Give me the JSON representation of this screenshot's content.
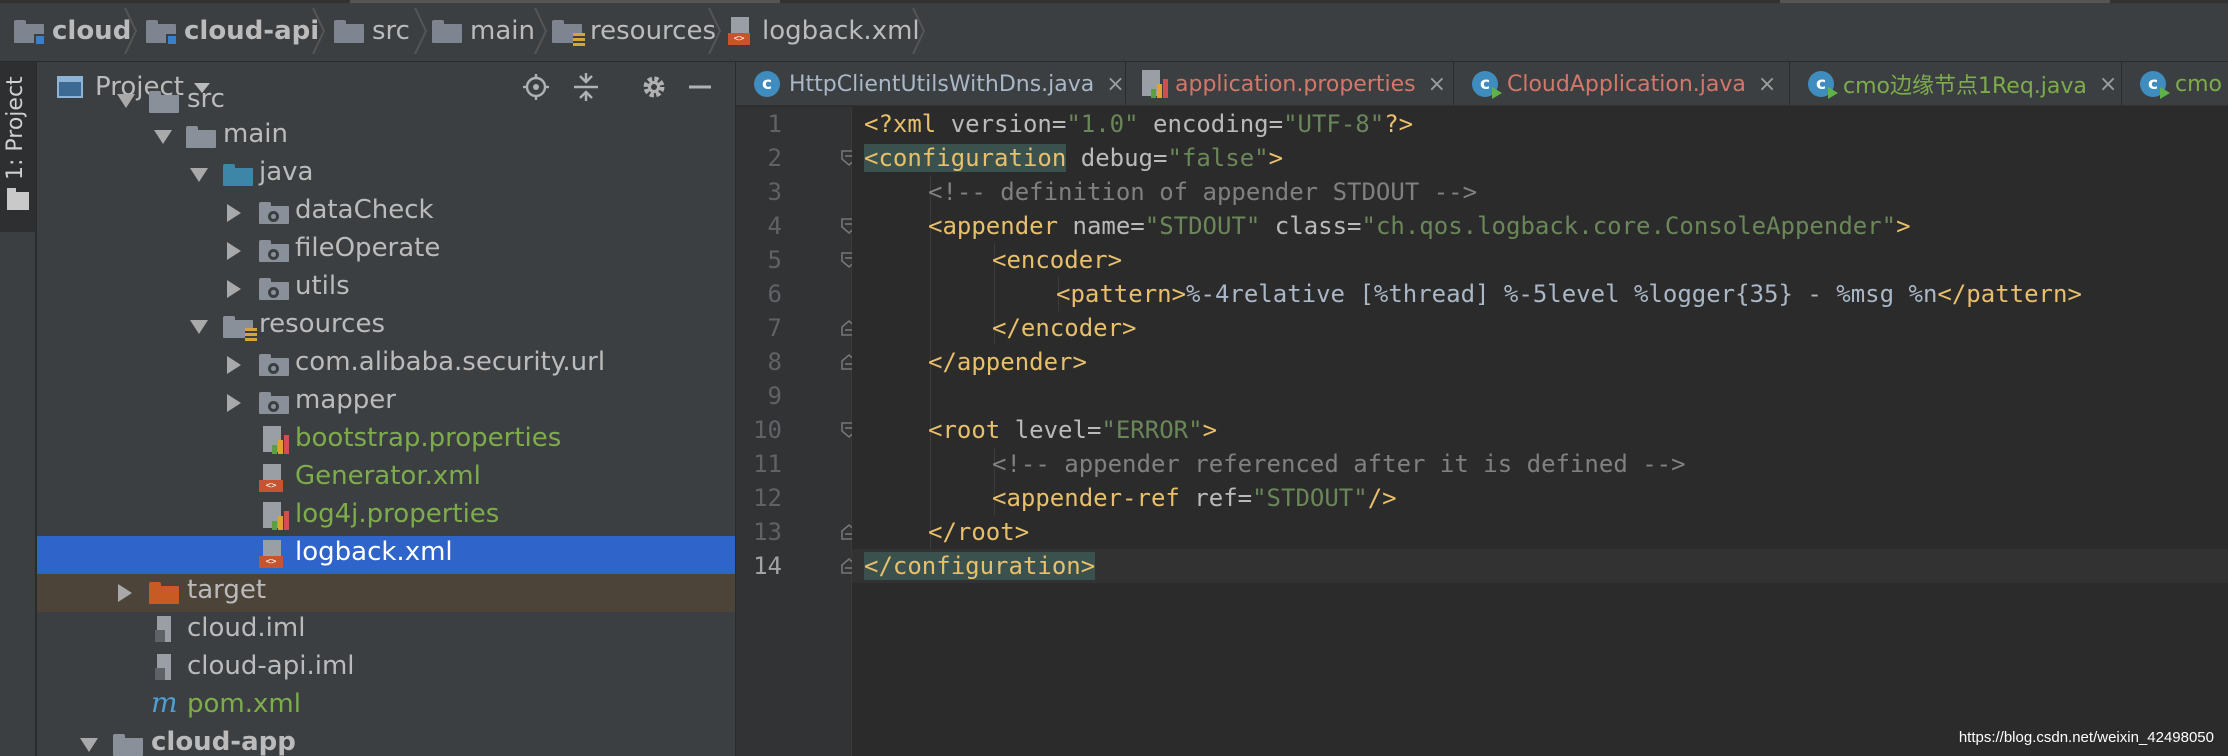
{
  "breadcrumb": {
    "items": [
      {
        "label": "cloud",
        "icon": "module-folder-icon"
      },
      {
        "label": "cloud-api",
        "icon": "module-folder-icon"
      },
      {
        "label": "src",
        "icon": "folder-icon"
      },
      {
        "label": "main",
        "icon": "folder-icon"
      },
      {
        "label": "resources",
        "icon": "resources-folder-icon"
      },
      {
        "label": "logback.xml",
        "icon": "xml-file-icon"
      }
    ]
  },
  "stripe": {
    "project_tab": "1: Project"
  },
  "project_panel": {
    "title": "Project",
    "tree": [
      {
        "label": "src",
        "type": "folder",
        "expanded": true
      },
      {
        "label": "main",
        "type": "folder",
        "expanded": true
      },
      {
        "label": "java",
        "type": "source-folder",
        "expanded": true
      },
      {
        "label": "dataCheck",
        "type": "package",
        "expanded": false
      },
      {
        "label": "fileOperate",
        "type": "package",
        "expanded": false
      },
      {
        "label": "utils",
        "type": "package",
        "expanded": false
      },
      {
        "label": "resources",
        "type": "resources-folder",
        "expanded": true
      },
      {
        "label": "com.alibaba.security.url",
        "type": "package",
        "expanded": false
      },
      {
        "label": "mapper",
        "type": "package",
        "expanded": false
      },
      {
        "label": "bootstrap.properties",
        "type": "properties"
      },
      {
        "label": "Generator.xml",
        "type": "xml"
      },
      {
        "label": "log4j.properties",
        "type": "properties"
      },
      {
        "label": "logback.xml",
        "type": "xml",
        "selected": true
      },
      {
        "label": "target",
        "type": "excluded-folder",
        "expanded": false
      },
      {
        "label": "cloud.iml",
        "type": "iml"
      },
      {
        "label": "cloud-api.iml",
        "type": "iml"
      },
      {
        "label": "pom.xml",
        "type": "maven"
      },
      {
        "label": "cloud-app",
        "type": "module-folder",
        "expanded": true
      }
    ]
  },
  "tabs": [
    {
      "label": "HttpClientUtilsWithDns.java",
      "color": "#a9b7c6",
      "icon": "class-icon"
    },
    {
      "label": "application.properties",
      "color": "#d2786b",
      "icon": "properties-file-icon"
    },
    {
      "label": "CloudApplication.java",
      "color": "#d2786b",
      "icon": "runnable-class-icon"
    },
    {
      "label": "cmo边缘节点1Req.java",
      "color": "#7dac4a",
      "icon": "class-icon"
    },
    {
      "label": "cmo",
      "color": "#7dac4a",
      "icon": "class-icon"
    }
  ],
  "editor": {
    "line_numbers": [
      "1",
      "2",
      "3",
      "4",
      "5",
      "6",
      "7",
      "8",
      "9",
      "10",
      "11",
      "12",
      "13",
      "14"
    ],
    "current_line": 14,
    "lines": {
      "l1": {
        "a": "<?xml ",
        "b": "version",
        "c": "=",
        "d": "\"1.0\"",
        "e": " encoding",
        "f": "=",
        "g": "\"UTF-8\"",
        "h": "?>"
      },
      "l2": {
        "a": "<configuration",
        "b": " debug",
        "c": "=",
        "d": "\"false\"",
        "e": ">"
      },
      "l3": {
        "a": "<!-- definition of appender STDOUT -->"
      },
      "l4": {
        "a": "<appender",
        "b": " name",
        "c": "=",
        "d": "\"STDOUT\"",
        "e": " class",
        "f": "=",
        "g": "\"ch.qos.logback.core.ConsoleAppender\"",
        "h": ">"
      },
      "l5": {
        "a": "<encoder>"
      },
      "l6": {
        "a": "<pattern>",
        "b": "%-4relative [%thread] %-5level %logger{35} - %msg %n",
        "c": "</pattern>"
      },
      "l7": {
        "a": "</encoder>"
      },
      "l8": {
        "a": "</appender>"
      },
      "l10": {
        "a": "<root",
        "b": " level",
        "c": "=",
        "d": "\"ERROR\"",
        "e": ">"
      },
      "l11": {
        "a": "<!-- appender referenced after it is defined -->"
      },
      "l12": {
        "a": "<appender-ref",
        "b": " ref",
        "c": "=",
        "d": "\"STDOUT\"",
        "e": "/>"
      },
      "l13": {
        "a": "</root>"
      },
      "l14": {
        "a": "</configuration>"
      }
    }
  },
  "watermark": "https://blog.csdn.net/weixin_42498050",
  "colors": {
    "background": "#2b2b2b",
    "panel": "#3c3f41",
    "selection": "#2f65ca",
    "xml_tag": "#e8bf6a",
    "xml_value": "#6a8759",
    "comment": "#808080"
  }
}
